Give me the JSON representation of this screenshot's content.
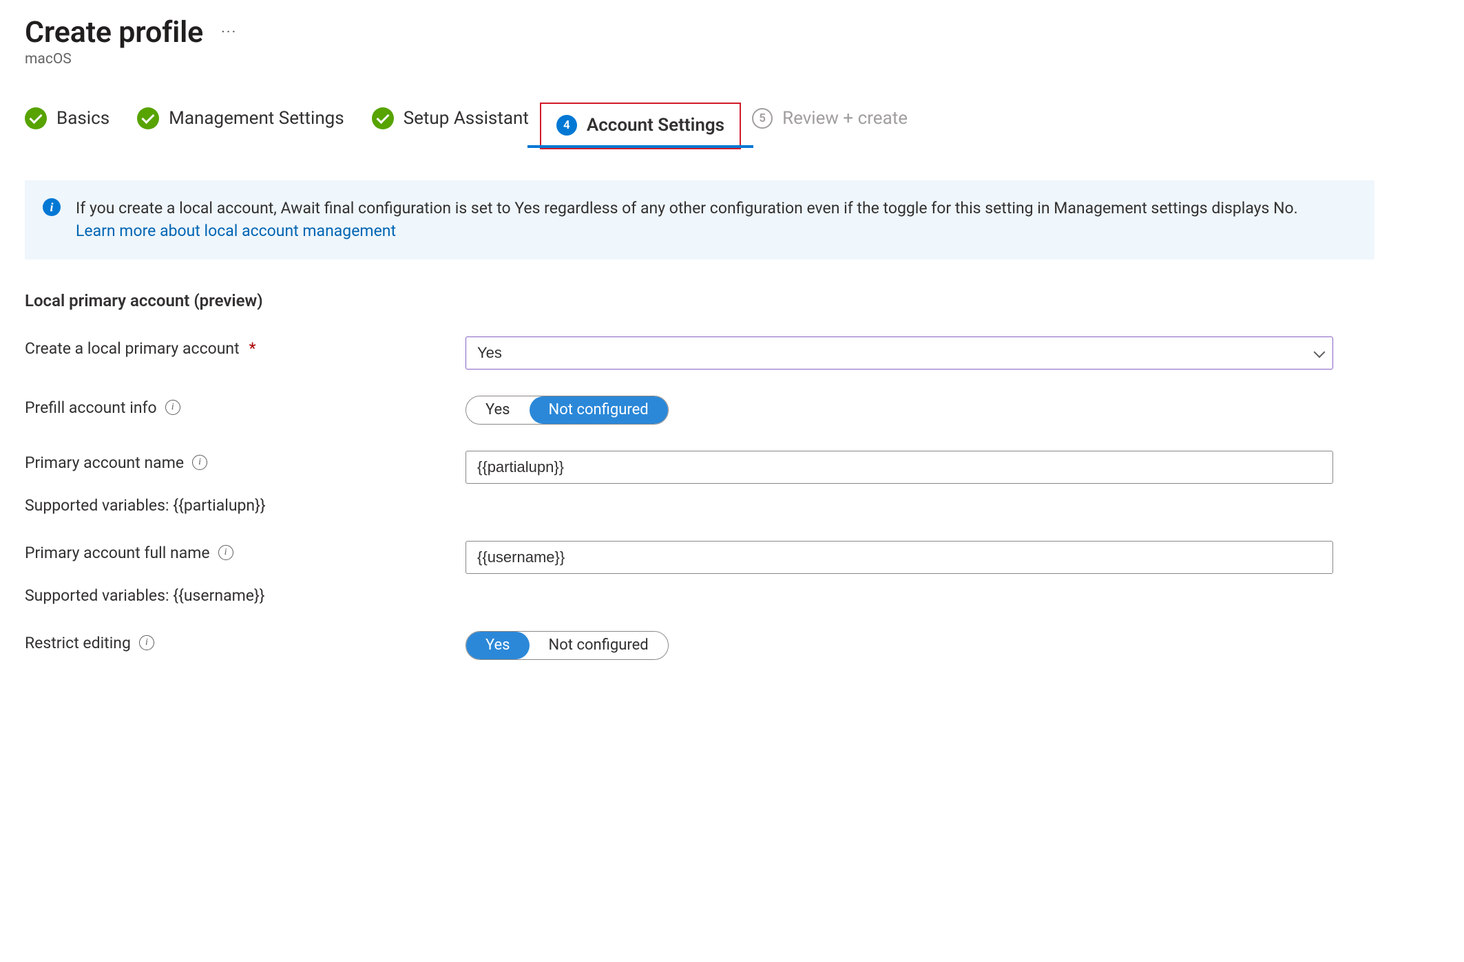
{
  "header": {
    "title": "Create profile",
    "subtitle": "macOS"
  },
  "steps": {
    "basics": {
      "label": "Basics"
    },
    "management": {
      "label": "Management Settings"
    },
    "setup": {
      "label": "Setup Assistant"
    },
    "account": {
      "label": "Account Settings",
      "num": "4"
    },
    "review": {
      "label": "Review + create",
      "num": "5"
    }
  },
  "info": {
    "text": "If you create a local account, Await final configuration is set to Yes regardless of any other configuration even if the toggle for this setting in Management settings displays No. ",
    "link": "Learn more about local account management"
  },
  "section": {
    "title": "Local primary account (preview)"
  },
  "form": {
    "create_local": {
      "label": "Create a local primary account",
      "value": "Yes"
    },
    "prefill": {
      "label": "Prefill account info",
      "options": {
        "yes": "Yes",
        "not": "Not configured"
      },
      "selected": "not"
    },
    "account_name": {
      "label": "Primary account name",
      "value": "{{partialupn}}",
      "supported": "Supported variables: {{partialupn}}"
    },
    "full_name": {
      "label": "Primary account full name",
      "value": "{{username}}",
      "supported": "Supported variables: {{username}}"
    },
    "restrict": {
      "label": "Restrict editing",
      "options": {
        "yes": "Yes",
        "not": "Not configured"
      },
      "selected": "yes"
    }
  }
}
